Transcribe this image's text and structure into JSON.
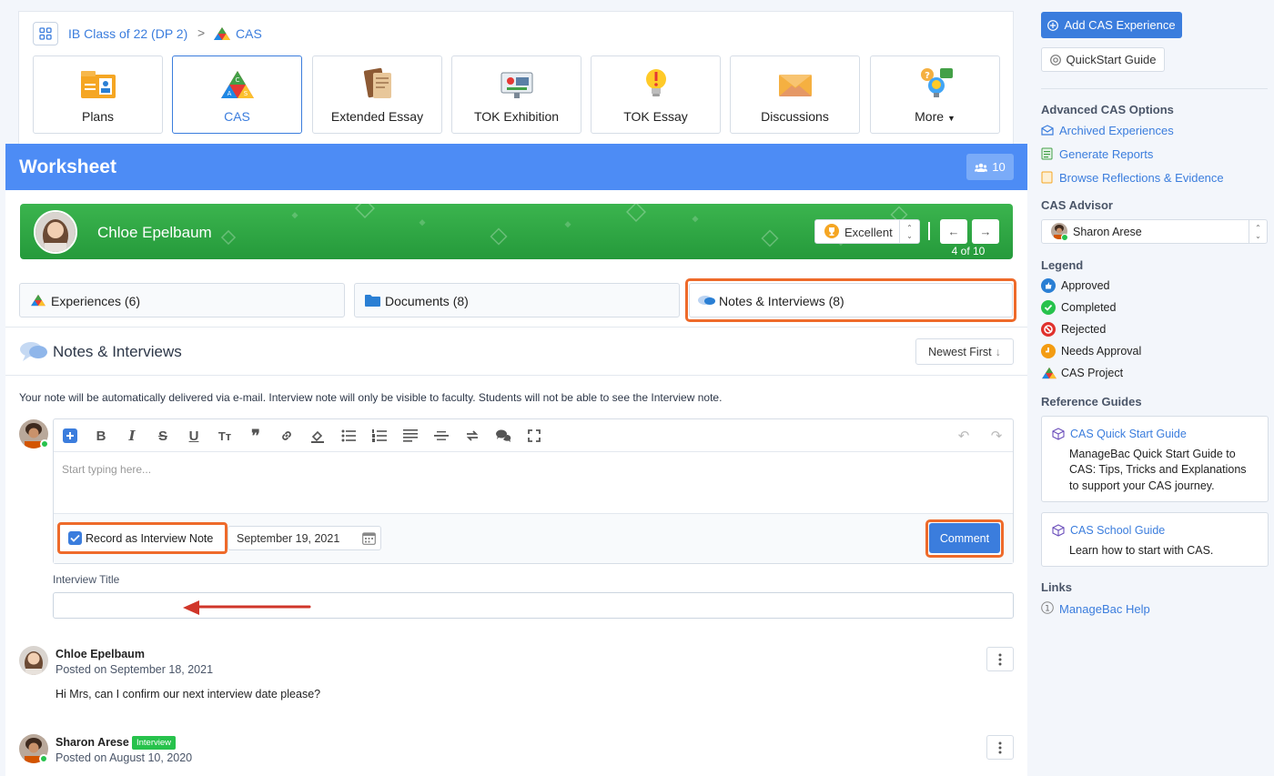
{
  "breadcrumb": {
    "class_name": "IB Class of 22 (DP 2)",
    "separator": ">",
    "current": "CAS"
  },
  "tiles": [
    {
      "label": "Plans",
      "icon": "plans-icon"
    },
    {
      "label": "CAS",
      "icon": "cas-icon",
      "active": true
    },
    {
      "label": "Extended Essay",
      "icon": "extended-essay-icon"
    },
    {
      "label": "TOK Exhibition",
      "icon": "tok-exhibition-icon"
    },
    {
      "label": "TOK Essay",
      "icon": "tok-essay-icon"
    },
    {
      "label": "Discussions",
      "icon": "discussions-icon"
    },
    {
      "label": "More",
      "icon": "more-icon"
    }
  ],
  "worksheet": {
    "title": "Worksheet",
    "member_count": "10",
    "student": {
      "name": "Chloe Epelbaum",
      "grade": "Excellent",
      "pager": "4 of 10"
    },
    "tabs": {
      "experiences": "Experiences (6)",
      "documents": "Documents (8)",
      "notes": "Notes & Interviews (8)"
    },
    "section_title": "Notes & Interviews",
    "sort_label": "Newest First",
    "info_text": "Your note will be automatically delivered via e-mail. Interview note will only be visible to faculty. Students will not be able to see the Interview note.",
    "editor": {
      "placeholder": "Start typing here...",
      "record_label": "Record as Interview Note",
      "record_checked": true,
      "date": "September 19, 2021",
      "comment_label": "Comment"
    },
    "interview_title_label": "Interview Title",
    "posts": [
      {
        "author": "Chloe Epelbaum",
        "date": "Posted on September 18, 2021",
        "body": "Hi Mrs, can I confirm our next interview date please?"
      },
      {
        "author": "Sharon Arese",
        "badge": "Interview",
        "date": "Posted on August 10, 2020"
      }
    ]
  },
  "sidebar": {
    "add_button": "Add CAS Experience",
    "quickstart_button": "QuickStart Guide",
    "advanced_heading": "Advanced CAS Options",
    "advanced_links": [
      "Archived Experiences",
      "Generate Reports",
      "Browse Reflections & Evidence"
    ],
    "advisor_heading": "CAS Advisor",
    "advisor_name": "Sharon Arese",
    "legend_heading": "Legend",
    "legend": [
      {
        "label": "Approved",
        "color": "#2a7fd4"
      },
      {
        "label": "Completed",
        "color": "#27c24c"
      },
      {
        "label": "Rejected",
        "color": "#e0312d"
      },
      {
        "label": "Needs Approval",
        "color": "#f39c12"
      },
      {
        "label": "CAS Project"
      }
    ],
    "reference_heading": "Reference Guides",
    "guides": [
      {
        "title": "CAS Quick Start Guide",
        "lines": [
          "ManageBac Quick Start Guide to",
          "CAS: Tips, Tricks and Explanations",
          "to support your CAS journey."
        ]
      },
      {
        "title": "CAS School Guide",
        "lines": [
          "Learn how to start with CAS."
        ]
      }
    ],
    "links_heading": "Links",
    "help_link": "ManageBac Help"
  },
  "colors": {
    "accent": "#3b7ddd",
    "header": "#4d8cf5",
    "student_bar": "#2fa645",
    "highlight": "#ee6a2a"
  }
}
